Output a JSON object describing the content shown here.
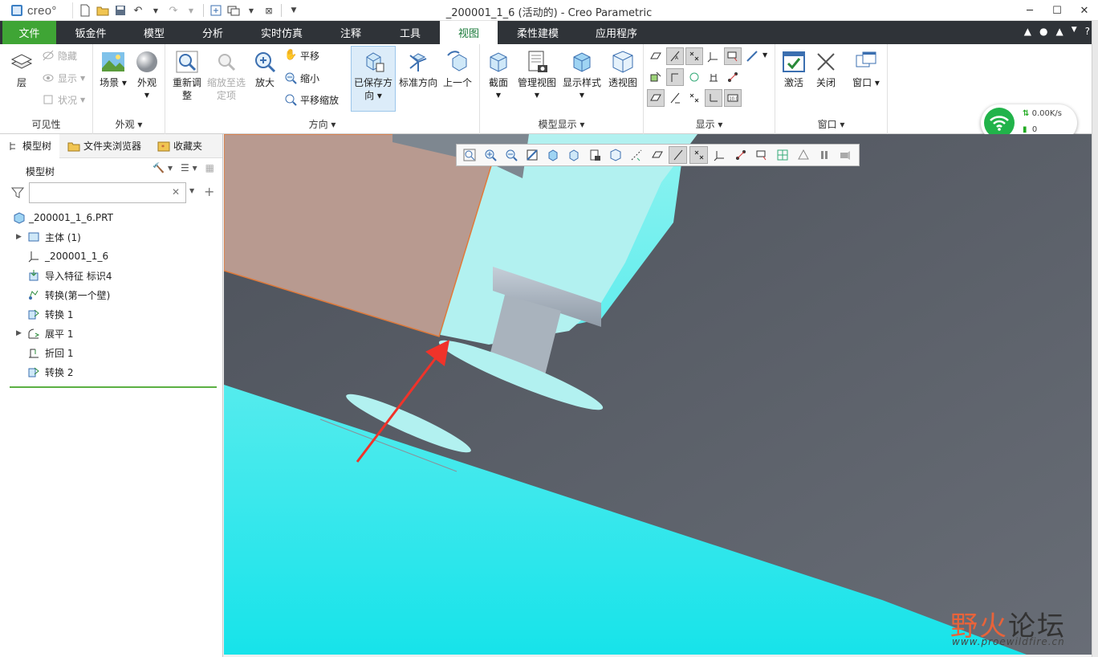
{
  "app": {
    "logo_text": "creo°",
    "window_title": "_200001_1_6 (活动的) - Creo Parametric"
  },
  "quick_access": [
    "new-icon",
    "open-icon",
    "save-icon",
    "undo-icon",
    "redo-icon",
    "regenerate-icon",
    "windows-icon",
    "close-window-icon",
    "customize-icon"
  ],
  "window_controls": {
    "minimize": "─",
    "maximize": "☐",
    "close": "✕"
  },
  "tabs": [
    {
      "label": "文件"
    },
    {
      "label": "钣金件"
    },
    {
      "label": "模型"
    },
    {
      "label": "分析"
    },
    {
      "label": "实时仿真"
    },
    {
      "label": "注释"
    },
    {
      "label": "工具"
    },
    {
      "label": "视图"
    },
    {
      "label": "柔性建模"
    },
    {
      "label": "应用程序"
    }
  ],
  "active_tab": "视图",
  "ribbon": {
    "visibility": {
      "label": "可见性",
      "layer": "层",
      "hide": "隐藏",
      "show": "显示",
      "status": "状况"
    },
    "appearance": {
      "label": "外观",
      "scene": "场景",
      "appearance": "外观"
    },
    "orientation": {
      "label": "方向",
      "refit_line1": "重新调",
      "refit_line2": "整",
      "zoom_sel_line1": "缩放至选",
      "zoom_sel_line2": "定项",
      "zoom_in": "放大",
      "pan": "平移",
      "zoom_out": "缩小",
      "pan_zoom": "平移缩放",
      "saved_line1": "已保存方",
      "saved_line2": "向",
      "standard": "标准方向",
      "previous": "上一个"
    },
    "model_display": {
      "label": "模型显示",
      "section": "截面",
      "manage_views": "管理视图",
      "display_style": "显示样式",
      "perspective": "透视图"
    },
    "show": {
      "label": "显示"
    },
    "window": {
      "label": "窗口",
      "activate": "激活",
      "close": "关闭",
      "window": "窗口"
    }
  },
  "left_panel": {
    "tabs": [
      "模型树",
      "文件夹浏览器",
      "收藏夹"
    ],
    "tree_title": "模型树",
    "filter_placeholder": "",
    "tree": [
      {
        "label": "_200001_1_6.PRT",
        "icon": "part-icon",
        "expandable": false
      },
      {
        "label": "主体 (1)",
        "icon": "body-icon",
        "expandable": true
      },
      {
        "label": "_200001_1_6",
        "icon": "csys-icon",
        "expandable": false
      },
      {
        "label": "导入特征 标识4",
        "icon": "import-feature-icon",
        "expandable": false
      },
      {
        "label": "转换(第一个壁)",
        "icon": "convert-icon",
        "expandable": false
      },
      {
        "label": "转换 1",
        "icon": "convert-icon",
        "expandable": false
      },
      {
        "label": "展平 1",
        "icon": "unbend-icon",
        "expandable": true
      },
      {
        "label": "折回 1",
        "icon": "bendback-icon",
        "expandable": false
      },
      {
        "label": "转换 2",
        "icon": "convert-icon",
        "expandable": false
      }
    ]
  },
  "network_widget": {
    "speed": "0.00K/s",
    "count": "0"
  },
  "watermark": {
    "text_colored": "野火",
    "text_dark": "论坛",
    "url": "www.proewildfire.cn"
  },
  "colors": {
    "tab_bar": "#2f3338",
    "file_tab": "#3fa535",
    "model_body": "#5a5f68",
    "viewport_bg": "#3ee8ec",
    "highlight_face": "#b89a90",
    "arrow": "#f0332a"
  }
}
